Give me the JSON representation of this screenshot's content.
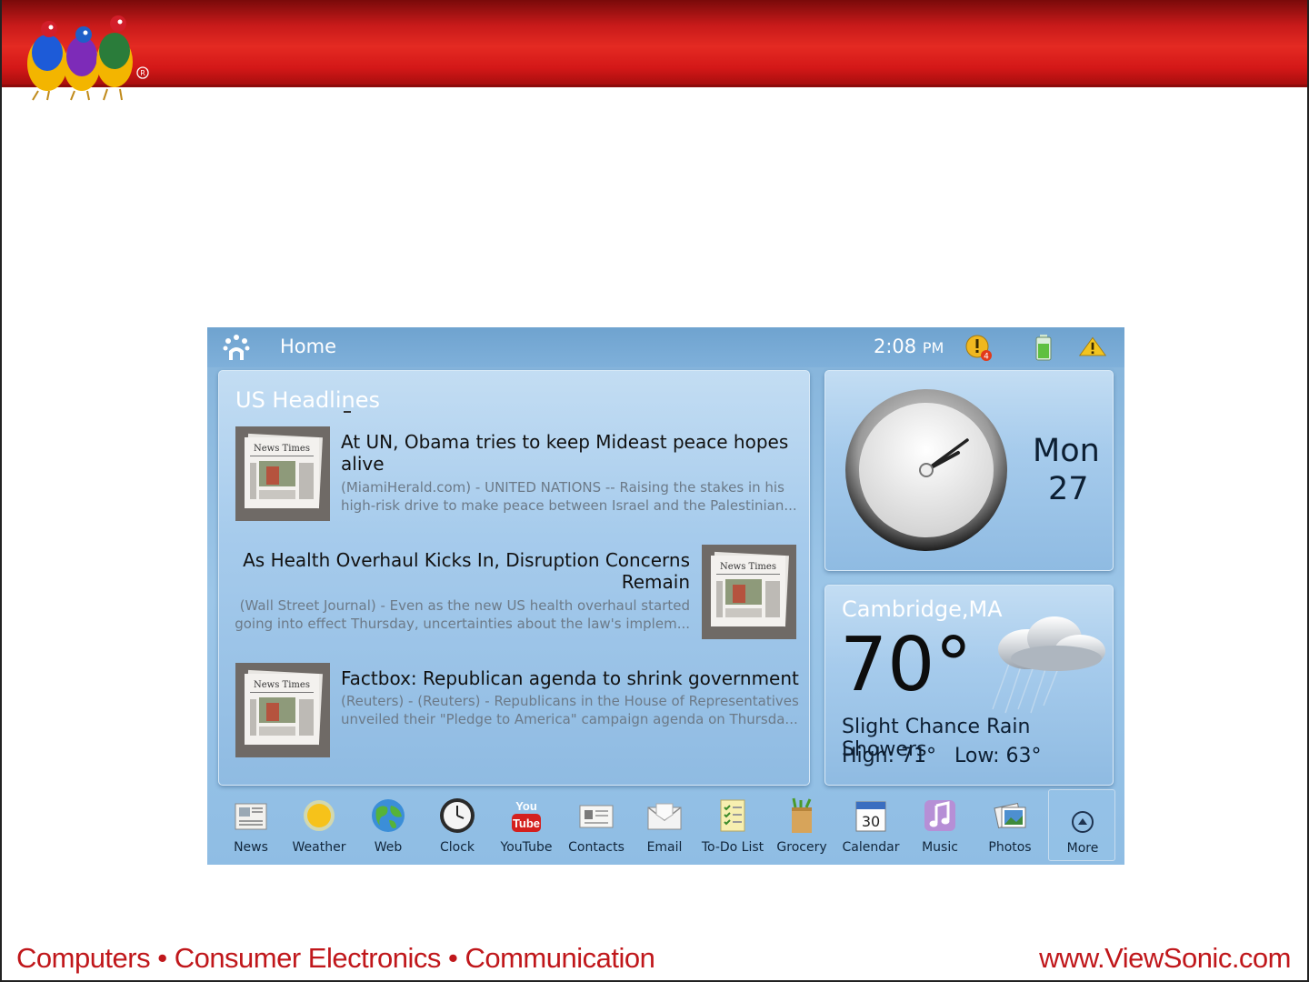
{
  "slide": {
    "footer_left": "Computers • Consumer Electronics • Communication",
    "footer_right": "www.ViewSonic.com"
  },
  "statusbar": {
    "title": "Home",
    "time": "2:08",
    "ampm": "PM",
    "notification_count": "4"
  },
  "headlines": {
    "title": "US Headlines",
    "stories": [
      {
        "headline_line1": "At UN, Obama tries to keep Mideast peace hopes",
        "headline_line2": "alive",
        "summary_line1": "(MiamiHerald.com) - UNITED NATIONS -- Raising the stakes in his",
        "summary_line2": "high-risk drive to make peace between Israel and the Palestinian..."
      },
      {
        "headline_line1": "As Health Overhaul Kicks In, Disruption Concerns",
        "headline_line2": "Remain",
        "summary_line1": "(Wall Street Journal) - Even as the new US health overhaul started",
        "summary_line2": "going into effect Thursday, uncertainties about the law's implem..."
      },
      {
        "headline_line1": "Factbox: Republican agenda to shrink government",
        "summary_line1": "(Reuters) - (Reuters) - Republicans in the House of Representatives",
        "summary_line2": "unveiled their \"Pledge to America\" campaign agenda on Thursda..."
      }
    ],
    "thumb_masthead": "News Times"
  },
  "clock": {
    "day_name": "Mon",
    "day_num": "27"
  },
  "weather": {
    "city": "Cambridge,MA",
    "temp": "70°",
    "desc": "Slight Chance Rain Showers",
    "high": "High: 71°",
    "low": "Low: 63°"
  },
  "dock": {
    "apps": [
      {
        "label": "News",
        "icon": "news-icon"
      },
      {
        "label": "Weather",
        "icon": "sun-icon"
      },
      {
        "label": "Web",
        "icon": "globe-icon"
      },
      {
        "label": "Clock",
        "icon": "clock-icon"
      },
      {
        "label": "YouTube",
        "icon": "youtube-icon",
        "icon_text_top": "You",
        "icon_text_bottom": "Tube"
      },
      {
        "label": "Contacts",
        "icon": "contacts-icon"
      },
      {
        "label": "Email",
        "icon": "envelope-icon"
      },
      {
        "label": "To-Do List",
        "icon": "checklist-icon"
      },
      {
        "label": "Grocery",
        "icon": "grocery-bag-icon"
      },
      {
        "label": "Calendar",
        "icon": "calendar-icon",
        "icon_text": "30"
      },
      {
        "label": "Music",
        "icon": "music-note-icon"
      },
      {
        "label": "Photos",
        "icon": "photos-icon"
      }
    ],
    "more_label": "More"
  },
  "colors": {
    "brand_red": "#c0171b",
    "screen_blue": "#8fbde4",
    "panel_title_white": "#ffffff"
  }
}
